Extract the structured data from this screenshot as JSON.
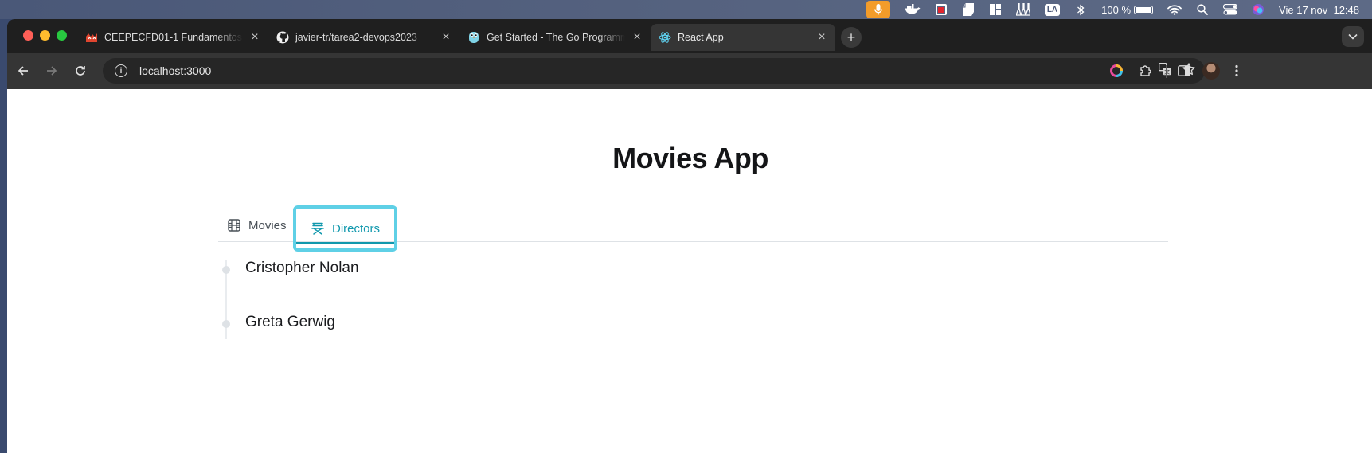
{
  "menubar": {
    "battery_text": "100 %",
    "date_time": "Vie 17 nov  12:48",
    "keyboard_layout": "LA",
    "icons": [
      "microphone-icon",
      "docker-icon",
      "screen-record-icon",
      "app-icon",
      "layout-icon",
      "lab-icon",
      "keyboard-layout-icon",
      "bluetooth-icon",
      "battery-icon",
      "wifi-icon",
      "spotlight-icon",
      "control-center-icon",
      "siri-icon"
    ]
  },
  "browser": {
    "tabs": [
      {
        "title": "CEEPECFD01-1 Fundamentos",
        "favicon": "moodle-icon",
        "active": false
      },
      {
        "title": "javier-tr/tarea2-devops2023",
        "favicon": "github-icon",
        "active": false
      },
      {
        "title": "Get Started - The Go Programming",
        "favicon": "go-gopher-icon",
        "active": false
      },
      {
        "title": "React App",
        "favicon": "react-icon",
        "active": true
      }
    ],
    "new_tab_symbol": "+",
    "address": "localhost:3000"
  },
  "app": {
    "title": "Movies App",
    "tabs": [
      {
        "label": "Movies",
        "icon": "film-icon",
        "active": false
      },
      {
        "label": "Directors",
        "icon": "director-chair-icon",
        "active": true
      }
    ],
    "directors": [
      "Cristopher Nolan",
      "Greta Gerwig"
    ]
  },
  "colors": {
    "accent": "#1098ad",
    "focus_ring": "#5fd0e6",
    "mic_badge": "#f39c2a"
  }
}
